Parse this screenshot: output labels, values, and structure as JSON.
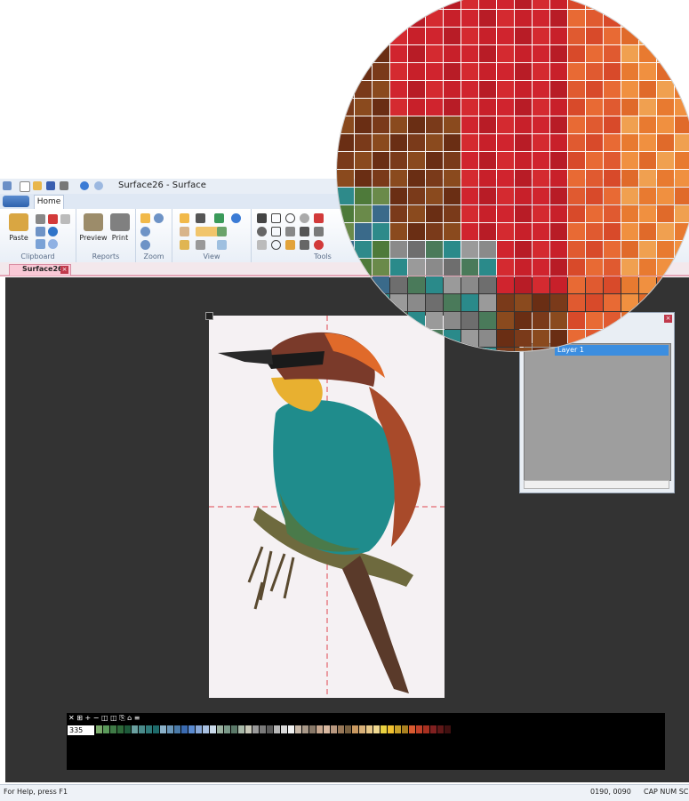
{
  "window": {
    "title": "Surface26 - Surface"
  },
  "ribbon": {
    "tab_home": "Home",
    "groups": {
      "clipboard": {
        "label": "Clipboard",
        "paste": "Paste"
      },
      "reports": {
        "label": "Reports",
        "preview": "Preview",
        "print": "Print"
      },
      "zoom": {
        "label": "Zoom"
      },
      "view": {
        "label": "View"
      },
      "tools": {
        "label": "Tools"
      }
    }
  },
  "document": {
    "tab_label": "Surface26"
  },
  "layers": {
    "items": [
      "Layer 1"
    ]
  },
  "palette": {
    "current_value": "335"
  },
  "statusbar": {
    "help": "For Help, press F1",
    "coords": "0190, 0090",
    "indicators": "CAP NUM SC"
  },
  "colors": {
    "accent": "#3c8ee0",
    "doc_tab": "#f9c9d6",
    "workspace": "#333333",
    "guide": "#e0454f"
  }
}
